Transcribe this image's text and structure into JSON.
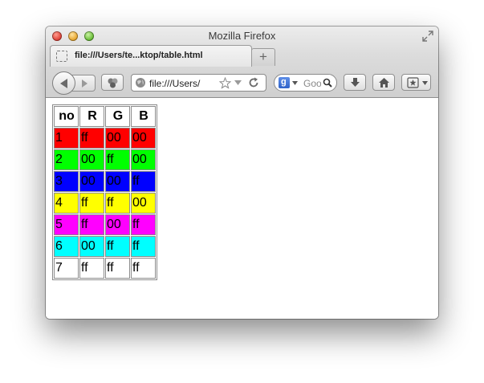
{
  "window": {
    "title": "Mozilla Firefox"
  },
  "tab": {
    "label": "file:///Users/te...ktop/table.html"
  },
  "newtab": {
    "label": "+"
  },
  "urlbar": {
    "value": "file:///Users/"
  },
  "search": {
    "value": "Goo"
  },
  "table": {
    "headers": [
      "no",
      "R",
      "G",
      "B"
    ],
    "rows": [
      {
        "cells": [
          "1",
          "ff",
          "00",
          "00"
        ],
        "color": "#ff0000"
      },
      {
        "cells": [
          "2",
          "00",
          "ff",
          "00"
        ],
        "color": "#00ff00"
      },
      {
        "cells": [
          "3",
          "00",
          "00",
          "ff"
        ],
        "color": "#0000ff"
      },
      {
        "cells": [
          "4",
          "ff",
          "ff",
          "00"
        ],
        "color": "#ffff00"
      },
      {
        "cells": [
          "5",
          "ff",
          "00",
          "ff"
        ],
        "color": "#ff00ff"
      },
      {
        "cells": [
          "6",
          "00",
          "ff",
          "ff"
        ],
        "color": "#00ffff"
      },
      {
        "cells": [
          "7",
          "ff",
          "ff",
          "ff"
        ],
        "color": "#ffffff"
      }
    ]
  }
}
